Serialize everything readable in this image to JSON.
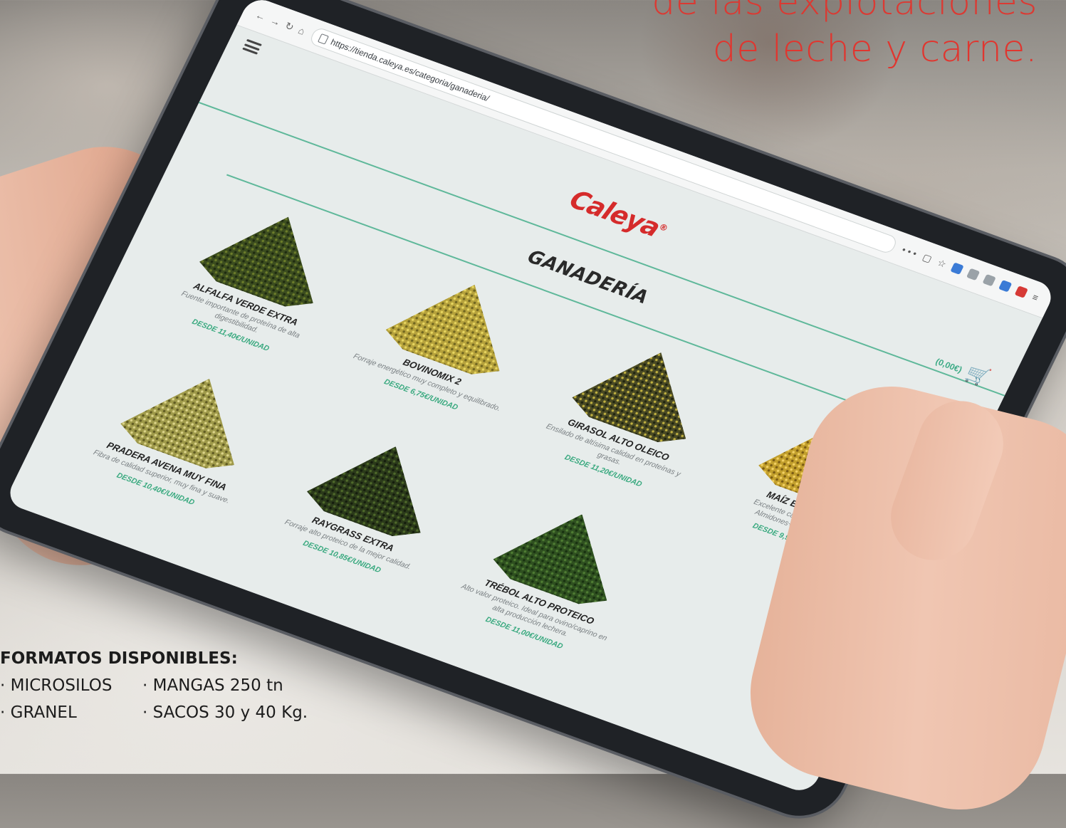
{
  "headline": {
    "line1": "de las explotaciones",
    "line2": "de leche y carne."
  },
  "formats": {
    "title": "FORMATOS DISPONIBLES:",
    "items": [
      "· MICROSILOS",
      "· MANGAS 250 tn",
      "· GRANEL",
      "· SACOS 30 y 40 Kg."
    ]
  },
  "browser": {
    "url": "https://tienda.caleya.es/categoria/ganaderia/",
    "nav_dots": "• • •"
  },
  "site": {
    "brand": "Caleya",
    "brand_mark": "®",
    "cart_total": "(0,00€)",
    "section_title": "GANADERÍA"
  },
  "products": [
    {
      "name": "ALFALFA VERDE EXTRA",
      "desc": "Fuente importante de proteína de alta digestibilidad.",
      "price": "DESDE 11,40€/UNIDAD",
      "pile": "dark-green"
    },
    {
      "name": "BOVINOMIX 2",
      "desc": "Forraje energético muy completo y equilibrado.",
      "price": "DESDE 6,75€/UNIDAD",
      "pile": "yellow"
    },
    {
      "name": "GIRASOL ALTO OLEICO",
      "desc": "Ensilado de altísima calidad en proteínas y grasas.",
      "price": "DESDE 11,20€/UNIDAD",
      "pile": "mixed"
    },
    {
      "name": "MAÍZ EXTRA ORO",
      "desc": "Excelente calidad nutricional. Almidones+fibra+energía.",
      "price": "DESDE 9,90€/UNIDAD",
      "pile": "golden"
    },
    {
      "name": "PRADERA AVENA MUY FINA",
      "desc": "Fibra de calidad superior, muy fina y suave.",
      "price": "DESDE 10,40€/UNIDAD",
      "pile": "straw"
    },
    {
      "name": "RAYGRASS EXTRA",
      "desc": "Forraje alto proteico de la mejor calidad.",
      "price": "DESDE 10,85€/UNIDAD",
      "pile": "deep-green"
    },
    {
      "name": "TRÉBOL ALTO PROTEICO",
      "desc": "Alto valor proteico. Ideal para ovino/caprino en alta producción lechera.",
      "price": "DESDE 11,00€/UNIDAD",
      "pile": "grass-green"
    }
  ],
  "colors": {
    "headline_red": "#e0362f",
    "brand_red": "#d52b2b",
    "accent_green": "#39a97f"
  }
}
